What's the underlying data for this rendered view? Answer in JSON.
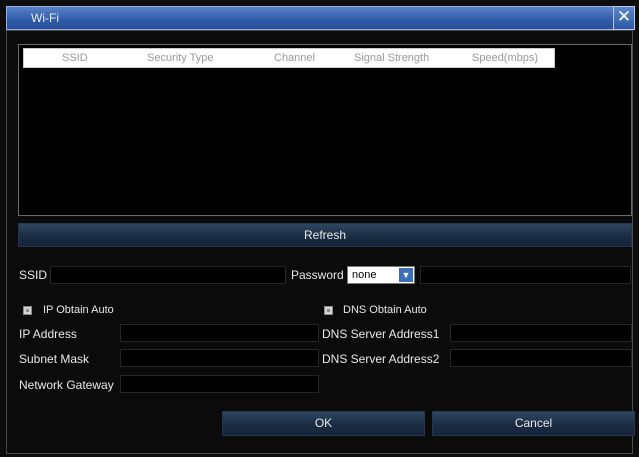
{
  "window": {
    "title": "Wi-Fi"
  },
  "table": {
    "columns": [
      "SSID",
      "Security Type",
      "Channel",
      "Signal Strength",
      "Speed(mbps)"
    ],
    "rows": []
  },
  "buttons": {
    "refresh": "Refresh",
    "ok": "OK",
    "cancel": "Cancel"
  },
  "form": {
    "ssid_label": "SSID",
    "ssid_value": "",
    "password_label": "Password",
    "password_select": "none",
    "password_value": "",
    "ip_auto_label": "IP Obtain Auto",
    "dns_auto_label": "DNS Obtain Auto",
    "ip_address_label": "IP Address",
    "subnet_mask_label": "Subnet Mask",
    "gateway_label": "Network Gateway",
    "dns1_label": "DNS Server Address1",
    "dns2_label": "DNS Server Address2"
  },
  "icons": {
    "close": "close-icon",
    "dropdown": "chevron-down-icon"
  },
  "colors": {
    "titlebar": "#2f5aa8",
    "button": "#1b2d43",
    "background": "#0d0d0d"
  }
}
